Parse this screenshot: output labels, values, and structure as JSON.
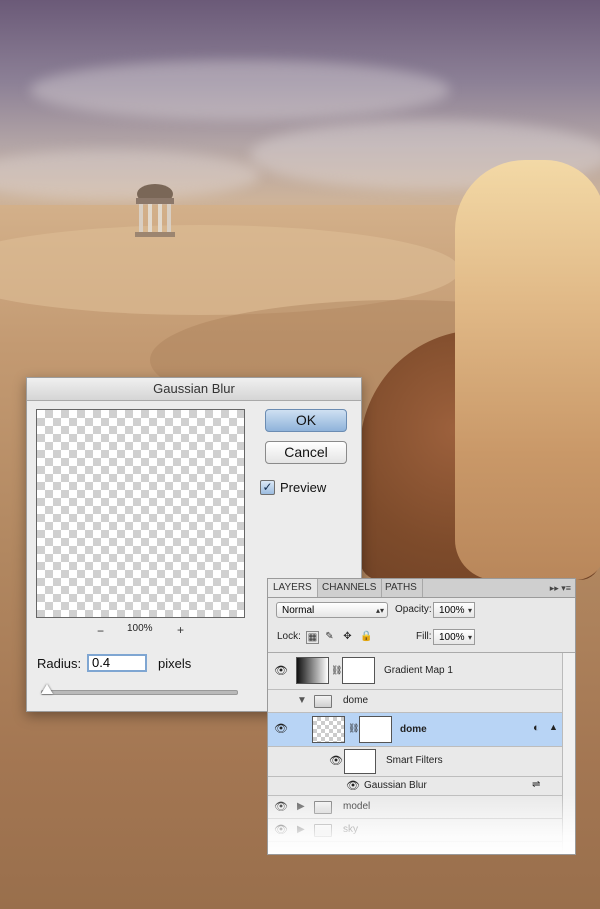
{
  "gaussian_blur": {
    "title": "Gaussian Blur",
    "ok_label": "OK",
    "cancel_label": "Cancel",
    "preview_label": "Preview",
    "preview_checked": true,
    "zoom_minus": "−",
    "zoom_level": "100%",
    "zoom_plus": "+",
    "radius_label": "Radius:",
    "radius_value": "0.4",
    "radius_unit": "pixels"
  },
  "layers_panel": {
    "tabs": [
      "LAYERS",
      "CHANNELS",
      "PATHS"
    ],
    "active_tab": "LAYERS",
    "panel_menu_icon": "▸▸  ▾≡",
    "blend_mode": "Normal",
    "opacity_label": "Opacity:",
    "opacity_value": "100%",
    "lock_label": "Lock:",
    "fill_label": "Fill:",
    "fill_value": "100%",
    "layers": [
      {
        "name": "Gradient Map 1",
        "kind": "adjustment",
        "visible": true
      },
      {
        "name": "dome",
        "kind": "group-expanded",
        "visible": false
      },
      {
        "name": "dome",
        "kind": "smart-object",
        "visible": true,
        "selected": true
      },
      {
        "name": "Smart Filters",
        "kind": "smart-filters",
        "visible": true
      },
      {
        "name": "Gaussian Blur",
        "kind": "filter",
        "visible": true
      },
      {
        "name": "model",
        "kind": "group-collapsed",
        "visible": true
      },
      {
        "name": "sky",
        "kind": "group-collapsed",
        "visible": true
      }
    ]
  },
  "colors": {
    "selected_row": "#b8d4f5",
    "dialog_bg": "#ececec",
    "ok_button": "#8fb3da"
  }
}
